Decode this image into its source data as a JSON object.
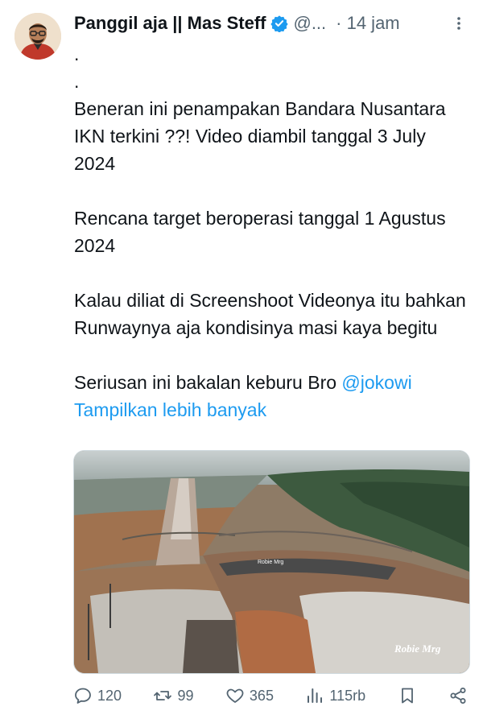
{
  "tweet": {
    "author_name": "Panggil aja || Mas Steff",
    "handle": "@...",
    "time": "· 14 jam",
    "lines": {
      "dot1": ".",
      "dot2": ".",
      "p1": "Beneran ini penampakan Bandara Nusantara IKN terkini ??! Video diambil tanggal 3 July 2024",
      "p2": "Rencana target beroperasi tanggal 1 Agustus 2024",
      "p3": "Kalau diliat di Screenshoot Videonya itu bahkan Runwaynya aja kondisinya masi kaya begitu",
      "p4_prefix": "Seriusan ini bakalan keburu Bro ",
      "p4_mention": "@jokowi"
    },
    "show_more": "Tampilkan lebih banyak",
    "media": {
      "watermark_small": "Robie Mrg",
      "watermark": "Robie Mrg"
    }
  },
  "actions": {
    "replies": "120",
    "reposts": "99",
    "likes": "365",
    "views": "115rb"
  },
  "colors": {
    "link": "#1d9bf0",
    "muted": "#536471",
    "text": "#0f1419"
  }
}
